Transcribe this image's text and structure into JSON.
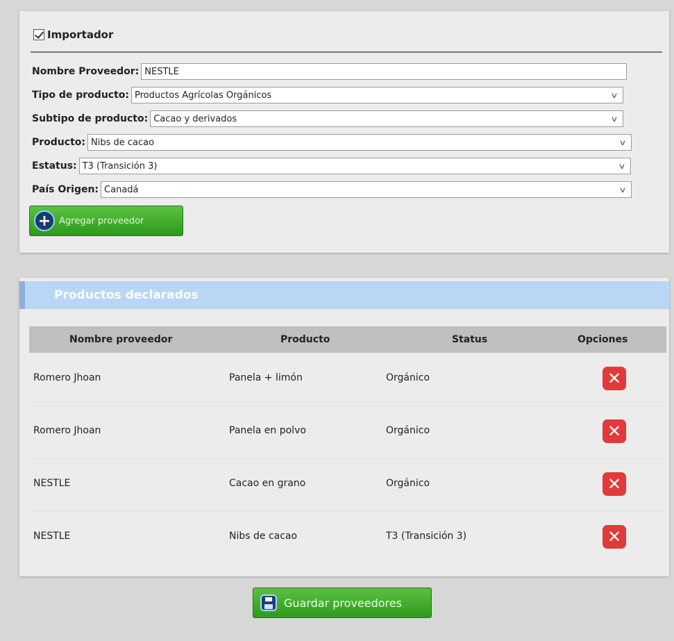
{
  "importer": {
    "label": "Importador",
    "checked": true
  },
  "form": {
    "supplier_name": {
      "label": "Nombre Proveedor:",
      "value": "NESTLE"
    },
    "product_type": {
      "label": "Tipo de producto:",
      "value": "Productos Agrícolas Orgánicos"
    },
    "product_subtype": {
      "label": "Subtipo de producto:",
      "value": "Cacao y derivados"
    },
    "product": {
      "label": "Producto:",
      "value": "Nibs de cacao"
    },
    "status": {
      "label": "Estatus:",
      "value": "T3 (Transición 3)"
    },
    "origin_country": {
      "label": "País Origen:",
      "value": "Canadá"
    }
  },
  "add_button": {
    "label": "Agregar proveedor",
    "icon": "plus-circle-icon"
  },
  "declared": {
    "title": "Productos declarados",
    "columns": [
      "Nombre proveedor",
      "Producto",
      "Status",
      "Opciones"
    ],
    "rows": [
      {
        "supplier": "Romero Jhoan",
        "product": "Panela + limón",
        "status": "Orgánico"
      },
      {
        "supplier": "Romero Jhoan",
        "product": "Panela en polvo",
        "status": "Orgánico"
      },
      {
        "supplier": "NESTLE",
        "product": "Cacao en grano",
        "status": "Orgánico"
      },
      {
        "supplier": "NESTLE",
        "product": "Nibs de cacao",
        "status": "T3 (Transición 3)"
      }
    ]
  },
  "save_button": {
    "label": "Guardar proveedores",
    "icon": "floppy-disk-icon"
  },
  "colors": {
    "accent_green": "#2d9a1c",
    "header_blue": "#b9d6f5",
    "delete_red": "#e23a3a"
  }
}
